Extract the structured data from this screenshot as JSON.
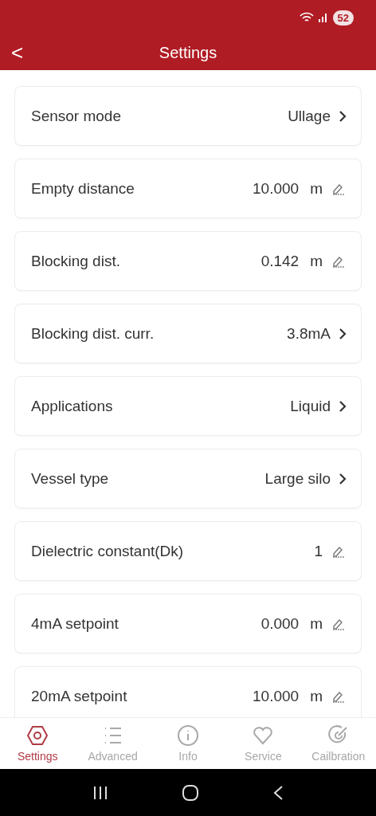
{
  "status_bar": {
    "battery": "52"
  },
  "header": {
    "back": "<",
    "title": "Settings"
  },
  "settings": [
    {
      "kind": "select",
      "label": "Sensor mode",
      "value": "Ullage"
    },
    {
      "kind": "edit",
      "label": "Empty distance",
      "value": "10.000",
      "unit": "m"
    },
    {
      "kind": "edit",
      "label": "Blocking dist.",
      "value": "0.142",
      "unit": "m"
    },
    {
      "kind": "select",
      "label": "Blocking dist. curr.",
      "value": "3.8mA"
    },
    {
      "kind": "select",
      "label": "Applications",
      "value": "Liquid"
    },
    {
      "kind": "select",
      "label": "Vessel type",
      "value": "Large silo"
    },
    {
      "kind": "edit",
      "label": "Dielectric constant(Dk)",
      "value": "1"
    },
    {
      "kind": "edit",
      "label": "4mA setpoint",
      "value": "0.000",
      "unit": "m"
    },
    {
      "kind": "edit",
      "label": "20mA setpoint",
      "value": "10.000",
      "unit": "m"
    }
  ],
  "tabs": [
    {
      "kind": "settings",
      "label": "Settings",
      "selected": true
    },
    {
      "kind": "advanced",
      "label": "Advanced",
      "selected": false
    },
    {
      "kind": "info",
      "label": "Info",
      "selected": false
    },
    {
      "kind": "service",
      "label": "Service",
      "selected": false
    },
    {
      "kind": "calibration",
      "label": "Cailbration",
      "selected": false
    }
  ]
}
